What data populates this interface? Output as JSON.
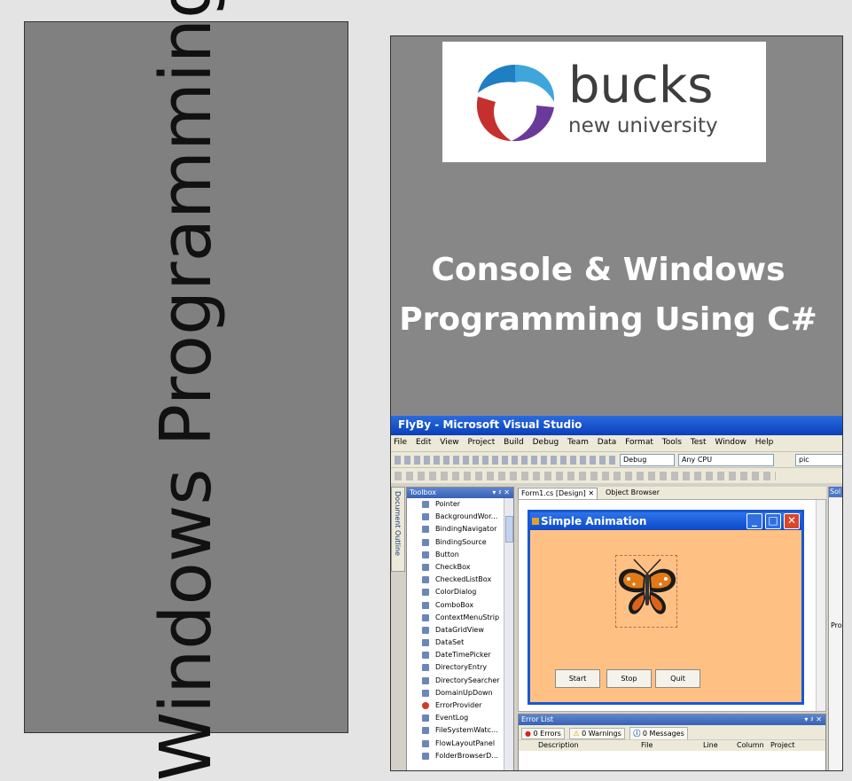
{
  "spine": {
    "title": "Windows Programming"
  },
  "cover": {
    "logo": {
      "name": "bucks",
      "subtitle": "new university"
    },
    "title_line1": "Console & Windows",
    "title_line2": "Programming Using C#"
  },
  "vs": {
    "window_title": "FlyBy - Microsoft Visual Studio",
    "menu": [
      "File",
      "Edit",
      "View",
      "Project",
      "Build",
      "Debug",
      "Team",
      "Data",
      "Format",
      "Tools",
      "Test",
      "Window",
      "Help"
    ],
    "config_combo": "Debug",
    "platform_combo": "Any CPU",
    "find_combo": "pic",
    "doc_outline_label": "Document Outline",
    "toolbox": {
      "title": "Toolbox",
      "controls": "▾ ♯ ✕",
      "items": [
        "Pointer",
        "BackgroundWor...",
        "BindingNavigator",
        "BindingSource",
        "Button",
        "CheckBox",
        "CheckedListBox",
        "ColorDialog",
        "ComboBox",
        "ContextMenuStrip",
        "DataGridView",
        "DataSet",
        "DateTimePicker",
        "DirectoryEntry",
        "DirectorySearcher",
        "DomainUpDown",
        "ErrorProvider",
        "EventLog",
        "FileSystemWatc...",
        "FlowLayoutPanel",
        "FolderBrowserD..."
      ]
    },
    "tabs": {
      "designer": "Form1.cs [Design]",
      "close": "✕",
      "object_browser": "Object Browser"
    },
    "form": {
      "title": "Simple Animation",
      "buttons": {
        "start": "Start",
        "stop": "Stop",
        "quit": "Quit"
      }
    },
    "error_list": {
      "title": "Error List",
      "controls": "▾ ♯ ✕",
      "errors": "0 Errors",
      "warnings": "0 Warnings",
      "messages": "0 Messages",
      "columns": {
        "description": "Description",
        "file": "File",
        "line": "Line",
        "column": "Column",
        "project": "Project"
      }
    },
    "right_panel": {
      "head": "Sol",
      "pr": "Pro"
    }
  },
  "colors": {
    "form_bg": "#ffc183",
    "titlebar": "#0b49c9",
    "cover_bg": "#878787",
    "spine_bg": "#808080"
  }
}
